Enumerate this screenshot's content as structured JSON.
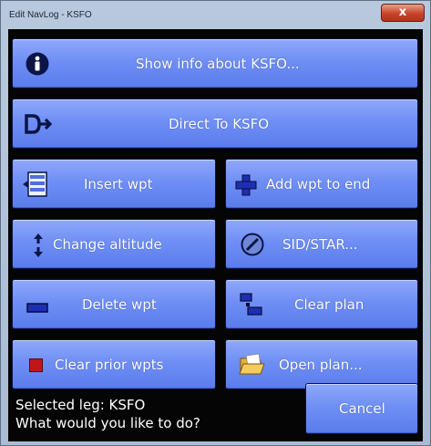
{
  "window": {
    "title": "Edit NavLog - KSFO",
    "close_glyph": "x"
  },
  "buttons": {
    "show_info": {
      "label": "Show info about KSFO...",
      "icon": "info-icon"
    },
    "direct_to": {
      "label": "Direct To KSFO",
      "icon": "direct-to-icon"
    },
    "insert_wpt": {
      "label": "Insert wpt",
      "icon": "insert-icon"
    },
    "add_wpt_end": {
      "label": "Add wpt to end",
      "icon": "plus-icon"
    },
    "change_alt": {
      "label": "Change altitude",
      "icon": "altitude-arrows-icon"
    },
    "sid_star": {
      "label": "SID/STAR...",
      "icon": "sid-star-icon"
    },
    "delete_wpt": {
      "label": "Delete wpt",
      "icon": "minus-icon"
    },
    "clear_plan": {
      "label": "Clear plan",
      "icon": "clear-plan-icon"
    },
    "clear_prior": {
      "label": "Clear prior wpts",
      "icon": "red-square-icon"
    },
    "open_plan": {
      "label": "Open plan...",
      "icon": "folder-icon"
    },
    "cancel": {
      "label": "Cancel"
    }
  },
  "status": {
    "selected_leg": "Selected leg: KSFO",
    "prompt": "What would you like to do?"
  },
  "colors": {
    "button_top": "#90a8fb",
    "button_bottom": "#5a7ceb",
    "background": "#050505",
    "close_red": "#c7442a"
  }
}
